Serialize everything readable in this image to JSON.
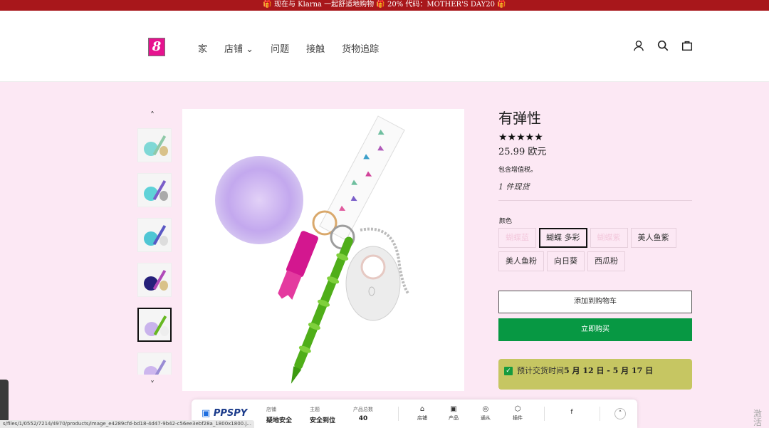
{
  "announcement": "🎁 现在与 Klarna 一起舒适地购物 🎁 20% 代码：MOTHER'S DAY20 🎁",
  "logo_text": "8",
  "nav": [
    "家",
    "店铺",
    "问题",
    "接触",
    "货物追踪"
  ],
  "nav_dropdown_index": 1,
  "header_icons": [
    "account-icon",
    "search-icon",
    "cart-icon"
  ],
  "gallery": {
    "up_arrow": "˄",
    "down_arrow": "˅",
    "thumb_count": 6,
    "active_thumb": 4
  },
  "product": {
    "title": "有弹性",
    "stars": "★★★★★",
    "rating": 5,
    "price": "25.99 欧元",
    "tax_note": "包含增值税。",
    "stock": "1 件现货",
    "color_label": "颜色",
    "colors": [
      {
        "label": "蝴蝶蓝",
        "state": "sold"
      },
      {
        "label": "蝴蝶 多彩",
        "state": "selected"
      },
      {
        "label": "蝴蝶紫",
        "state": "sold"
      },
      {
        "label": "美人鱼紫",
        "state": "normal"
      },
      {
        "label": "美人鱼粉",
        "state": "normal"
      },
      {
        "label": "向日葵",
        "state": "normal"
      },
      {
        "label": "西瓜粉",
        "state": "normal"
      }
    ],
    "add_to_cart": "添加到购物车",
    "buy_now": "立即购买",
    "delivery_prefix": "预计交货时间",
    "delivery_dates": "5 月 12 日 - 5 月 17 日"
  },
  "ppspy": {
    "brand": "PPSPY",
    "stats": [
      {
        "label": "店铺",
        "value": "疑地安全"
      },
      {
        "label": "主题",
        "value": "安全到位"
      },
      {
        "label": "产品总数",
        "value": "40"
      }
    ],
    "tools": [
      {
        "label": "店铺",
        "icon": "⌂"
      },
      {
        "label": "产品",
        "icon": "▣"
      },
      {
        "label": "通从",
        "icon": "◎"
      },
      {
        "label": "插件",
        "icon": "⬡"
      }
    ],
    "social_icon": "f",
    "collapse_icon": "˄"
  },
  "status_url": "s/files/1/0552/7214/4970/products/image_e4289cfd-bd18-4d47-9b42-c56ee3ebf28a_1800x1800.j...",
  "watermark": {
    "line1": "激活",
    "line2": "转到"
  },
  "colors": {
    "announce_bg": "#a8171b",
    "page_bg": "#fce8f4",
    "buy_btn": "#079843",
    "delivery_bg": "#c6c662",
    "logo": "#e6138f"
  }
}
